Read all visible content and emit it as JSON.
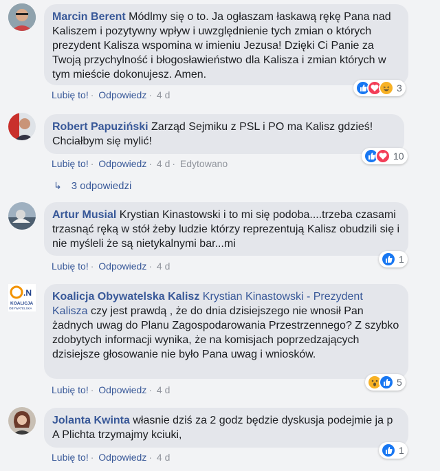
{
  "comments": [
    {
      "author": "Marcin Berent",
      "mention": "",
      "text": "Módlmy się o to. Ja ogłaszam łaskawą rękę Pana nad Kaliszem i pozytywny wpływ i uwzględnienie tych zmian o których prezydent Kalisza wspomina w imieniu Jezusa! Dzięki Ci Panie za Twoją przychylność i błogosławieństwo dla Kalisza i zmian których w tym mieście dokonujesz. Amen.",
      "like": "Lubię to!",
      "reply": "Odpowiedz",
      "time": "4 d",
      "edited": "",
      "reactions": [
        "like",
        "love",
        "haha"
      ],
      "reaction_count": "3"
    },
    {
      "author": "Robert Papuziński",
      "mention": "",
      "text": "Zarząd Sejmiku z PSL i PO ma Kalisz gdzieś! Chciałbym się mylić!",
      "like": "Lubię to!",
      "reply": "Odpowiedz",
      "time": "4 d",
      "edited": "Edytowano",
      "reactions": [
        "like",
        "love"
      ],
      "reaction_count": "10"
    },
    {
      "author": "Artur Musial",
      "mention": "",
      "text": "Krystian Kinastowski i to mi się podoba....trzeba czasami trzasnąć ręką w stół żeby ludzie którzy reprezentują Kalisz obudzili się i nie myśleli że są nietykalnymi bar...mi",
      "like": "Lubię to!",
      "reply": "Odpowiedz",
      "time": "4 d",
      "edited": "",
      "reactions": [
        "like"
      ],
      "reaction_count": "1"
    },
    {
      "author": "Koalicja Obywatelska Kalisz",
      "mention": "Krystian Kinastowski - Prezydent Kalisza",
      "text": "czy jest prawdą , że do dnia dzisiejszego nie wnosił Pan żadnych uwag do Planu Zagospodarowania Przestrzennego? Z szybko zdobytych informacji wynika, że na komisjach poprzedzających dzisiejsze głosowanie nie było Pana uwag i wniosków.",
      "like": "Lubię to!",
      "reply": "Odpowiedz",
      "time": "4 d",
      "edited": "",
      "reactions": [
        "wow",
        "like"
      ],
      "reaction_count": "5"
    },
    {
      "author": "Jolanta Kwinta",
      "mention": "",
      "text": "własnie dziś za 2 godz będzie dyskusja podejmie ja p A Plichta trzymajmy kciuki,",
      "like": "Lubię to!",
      "reply": "Odpowiedz",
      "time": "4 d",
      "edited": "",
      "reactions": [
        "like"
      ],
      "reaction_count": "1"
    }
  ],
  "replies_link": "3 odpowiedzi",
  "logo_text": ".N KOALICJA OBYWATELSKA",
  "colors": {
    "link": "#385898",
    "bubble": "#e4e6eb",
    "like": "#1877f2",
    "love": "#f33e58",
    "haha": "#f7b125"
  }
}
